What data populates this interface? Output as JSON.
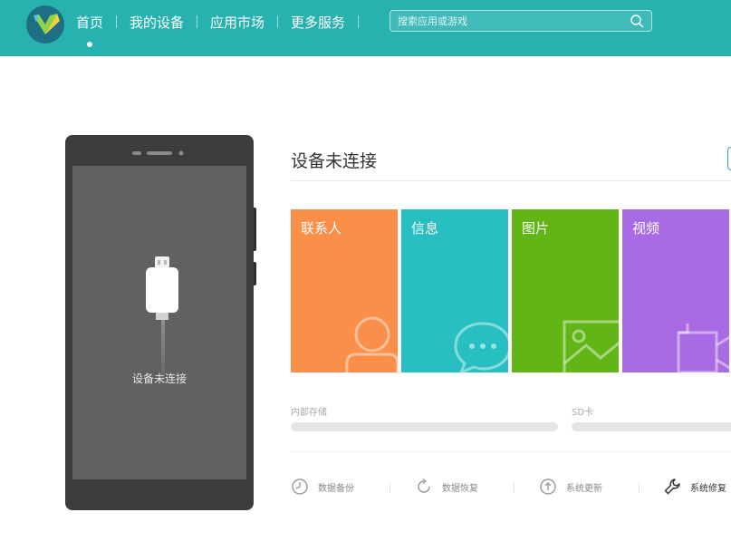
{
  "header": {
    "nav": [
      {
        "label": "首页",
        "active": true
      },
      {
        "label": "我的设备",
        "active": false
      },
      {
        "label": "应用市场",
        "active": false
      },
      {
        "label": "更多服务",
        "active": false
      }
    ],
    "search_placeholder": "搜索应用或游戏",
    "icons": {
      "logo": "app-logo",
      "search": "search-icon"
    }
  },
  "phone": {
    "status": "设备未连接"
  },
  "device": {
    "title": "设备未连接"
  },
  "tiles": [
    {
      "label": "联系人",
      "color": "#f98f49",
      "icon": "contact-icon"
    },
    {
      "label": "信息",
      "color": "#27bfc2",
      "icon": "message-icon"
    },
    {
      "label": "图片",
      "color": "#61b515",
      "icon": "image-icon"
    },
    {
      "label": "视频",
      "color": "#a86be4",
      "icon": "video-icon"
    }
  ],
  "storage": [
    {
      "label": "内部存储",
      "used_fraction": 0
    },
    {
      "label": "SD卡",
      "used_fraction": 0
    }
  ],
  "tools": [
    {
      "label": "数据备份",
      "icon": "backup-icon"
    },
    {
      "label": "数据恢复",
      "icon": "restore-icon"
    },
    {
      "label": "系统更新",
      "icon": "update-icon"
    },
    {
      "label": "系统修复",
      "icon": "wrench-icon"
    }
  ],
  "colors": {
    "accent": "#27b2b0"
  }
}
